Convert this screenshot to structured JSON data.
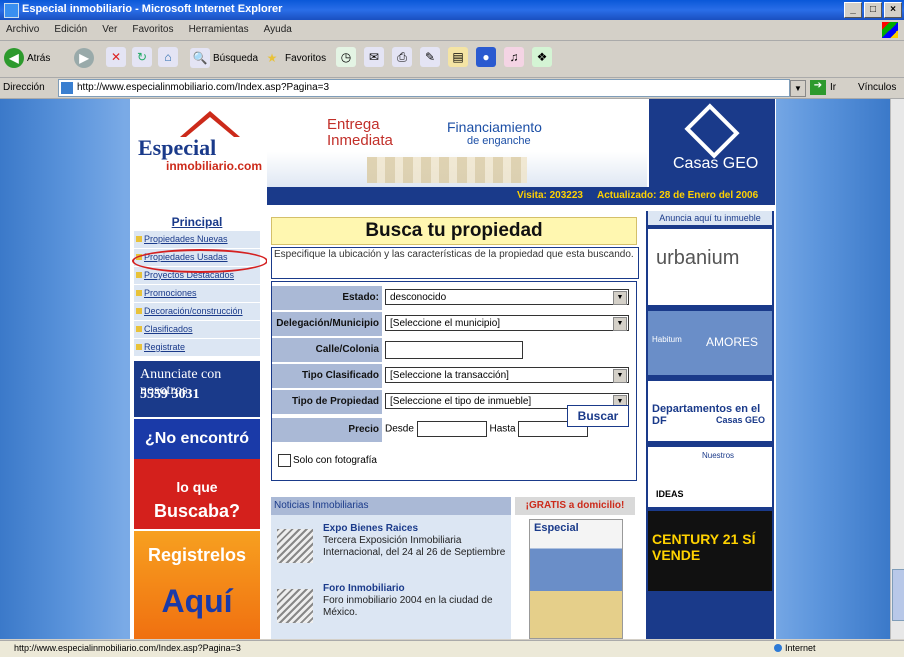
{
  "window": {
    "title": "Especial inmobiliario - Microsoft Internet Explorer"
  },
  "menu": [
    "Archivo",
    "Edición",
    "Ver",
    "Favoritos",
    "Herramientas",
    "Ayuda"
  ],
  "toolbar": {
    "back": "Atrás",
    "search": "Búsqueda",
    "favorites": "Favoritos"
  },
  "address": {
    "label": "Dirección",
    "url": "http://www.especialinmobiliario.com/Index.asp?Pagina=3",
    "go": "Ir",
    "links": "Vínculos"
  },
  "status": {
    "text": "http://www.especialinmobiliario.com/Index.asp?Pagina=3",
    "zone": "Internet"
  },
  "header": {
    "logo_top": "Especial",
    "logo_bottom": "inmobiliario.com",
    "banner_line1": "Entrega",
    "banner_line2": "Inmediata",
    "banner_f1": "Financiamiento",
    "banner_f2": "de enganche",
    "geo": "Casas GEO",
    "visits": "Visita: 203223",
    "updated": "Actualizado: 28 de Enero del 2006"
  },
  "nav": {
    "heading": "Principal",
    "items": [
      "Propiedades Nuevas",
      "Propiedades Usadas",
      "Proyectos Destacados",
      "Promociones",
      "Decoración/construcción",
      "Clasificados",
      "Registrate"
    ]
  },
  "left_ads": {
    "anunciate": "Anunciate con nosotros",
    "phone": "5559 3031",
    "no_encontro": "¿No encontró",
    "lo_que": "lo que",
    "buscaba": "Buscaba?",
    "registrelos": "Registrelos",
    "aqui": "Aquí"
  },
  "search": {
    "title": "Busca tu propiedad",
    "description": "Especifique la ubicación y las características de la propiedad que esta buscando.",
    "estado_label": "Estado:",
    "estado_value": "desconocido",
    "municipio_label": "Delegación/Municipio",
    "municipio_value": "[Seleccione el municipio]",
    "calle_label": "Calle/Colonia",
    "tipo_clas_label": "Tipo Clasificado",
    "tipo_clas_value": "[Seleccione la transacción]",
    "tipo_prop_label": "Tipo de Propiedad",
    "tipo_prop_value": "[Seleccione el tipo de inmueble]",
    "precio_label": "Precio",
    "desde": "Desde",
    "hasta": "Hasta",
    "solo_foto": "Solo con fotografía",
    "buscar": "Buscar"
  },
  "news": {
    "heading": "Noticias Inmobiliarias",
    "items": [
      {
        "title": "Expo Bienes Raices",
        "desc": "Tercera Exposición Inmobiliaria Internacional, del 24 al 26 de Septiembre"
      },
      {
        "title": "Foro Inmobiliario",
        "desc": "Foro inmobiliario 2004 en la ciudad de México."
      }
    ]
  },
  "gratis": {
    "heading": "¡GRATIS a domicilio!",
    "mag": "Especial"
  },
  "right": {
    "heading": "Anuncia aquí tu inmueble",
    "urbanium": "urbanium",
    "habitum": "Habitum",
    "amores": "AMORES",
    "df_text": "Departamentos en el DF",
    "geo_small": "Casas GEO",
    "ideas": "IDEAS",
    "nuestros": "Nuestros",
    "century": "CENTURY 21 SÍ VENDE"
  }
}
